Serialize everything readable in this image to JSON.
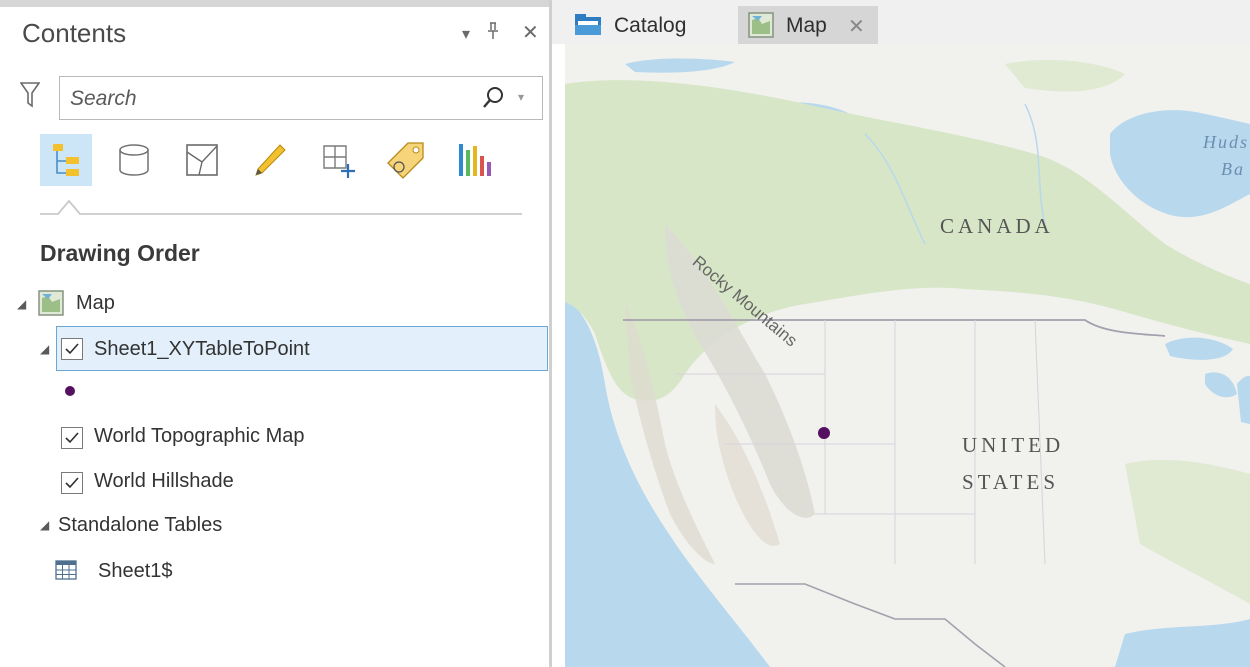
{
  "contents_pane": {
    "title": "Contents",
    "controls": {
      "menu": "▾",
      "pin": "⊥",
      "close": "✕"
    },
    "search": {
      "placeholder": "Search"
    },
    "tools": [
      "list-by-drawing-order-icon",
      "list-by-source-icon",
      "list-by-selection-icon",
      "list-by-editing-icon",
      "list-by-snapping-icon",
      "list-by-labeling-icon",
      "list-by-charts-icon"
    ],
    "section_title": "Drawing Order",
    "map_node": {
      "label": "Map"
    },
    "layers": [
      {
        "label": "Sheet1_XYTableToPoint",
        "checked": true,
        "selected": true
      },
      {
        "label": "World Topographic Map",
        "checked": true
      },
      {
        "label": "World Hillshade",
        "checked": true
      }
    ],
    "standalone_tables": {
      "label": "Standalone Tables",
      "items": [
        {
          "label": "Sheet1$"
        }
      ]
    }
  },
  "view_tabs": [
    {
      "label": "Catalog",
      "active": false
    },
    {
      "label": "Map",
      "active": true,
      "close": "✕"
    }
  ],
  "map": {
    "labels": {
      "canada": "CANADA",
      "united": "UNITED",
      "states": "STATES",
      "rocky": "Rocky Mountains",
      "hudson_1": "Huds",
      "hudson_2": "Ba"
    },
    "colors": {
      "water": "#b8d8ee",
      "land": "#f1f1ed",
      "forest": "#d7e6c6",
      "point": "#55105f"
    }
  }
}
